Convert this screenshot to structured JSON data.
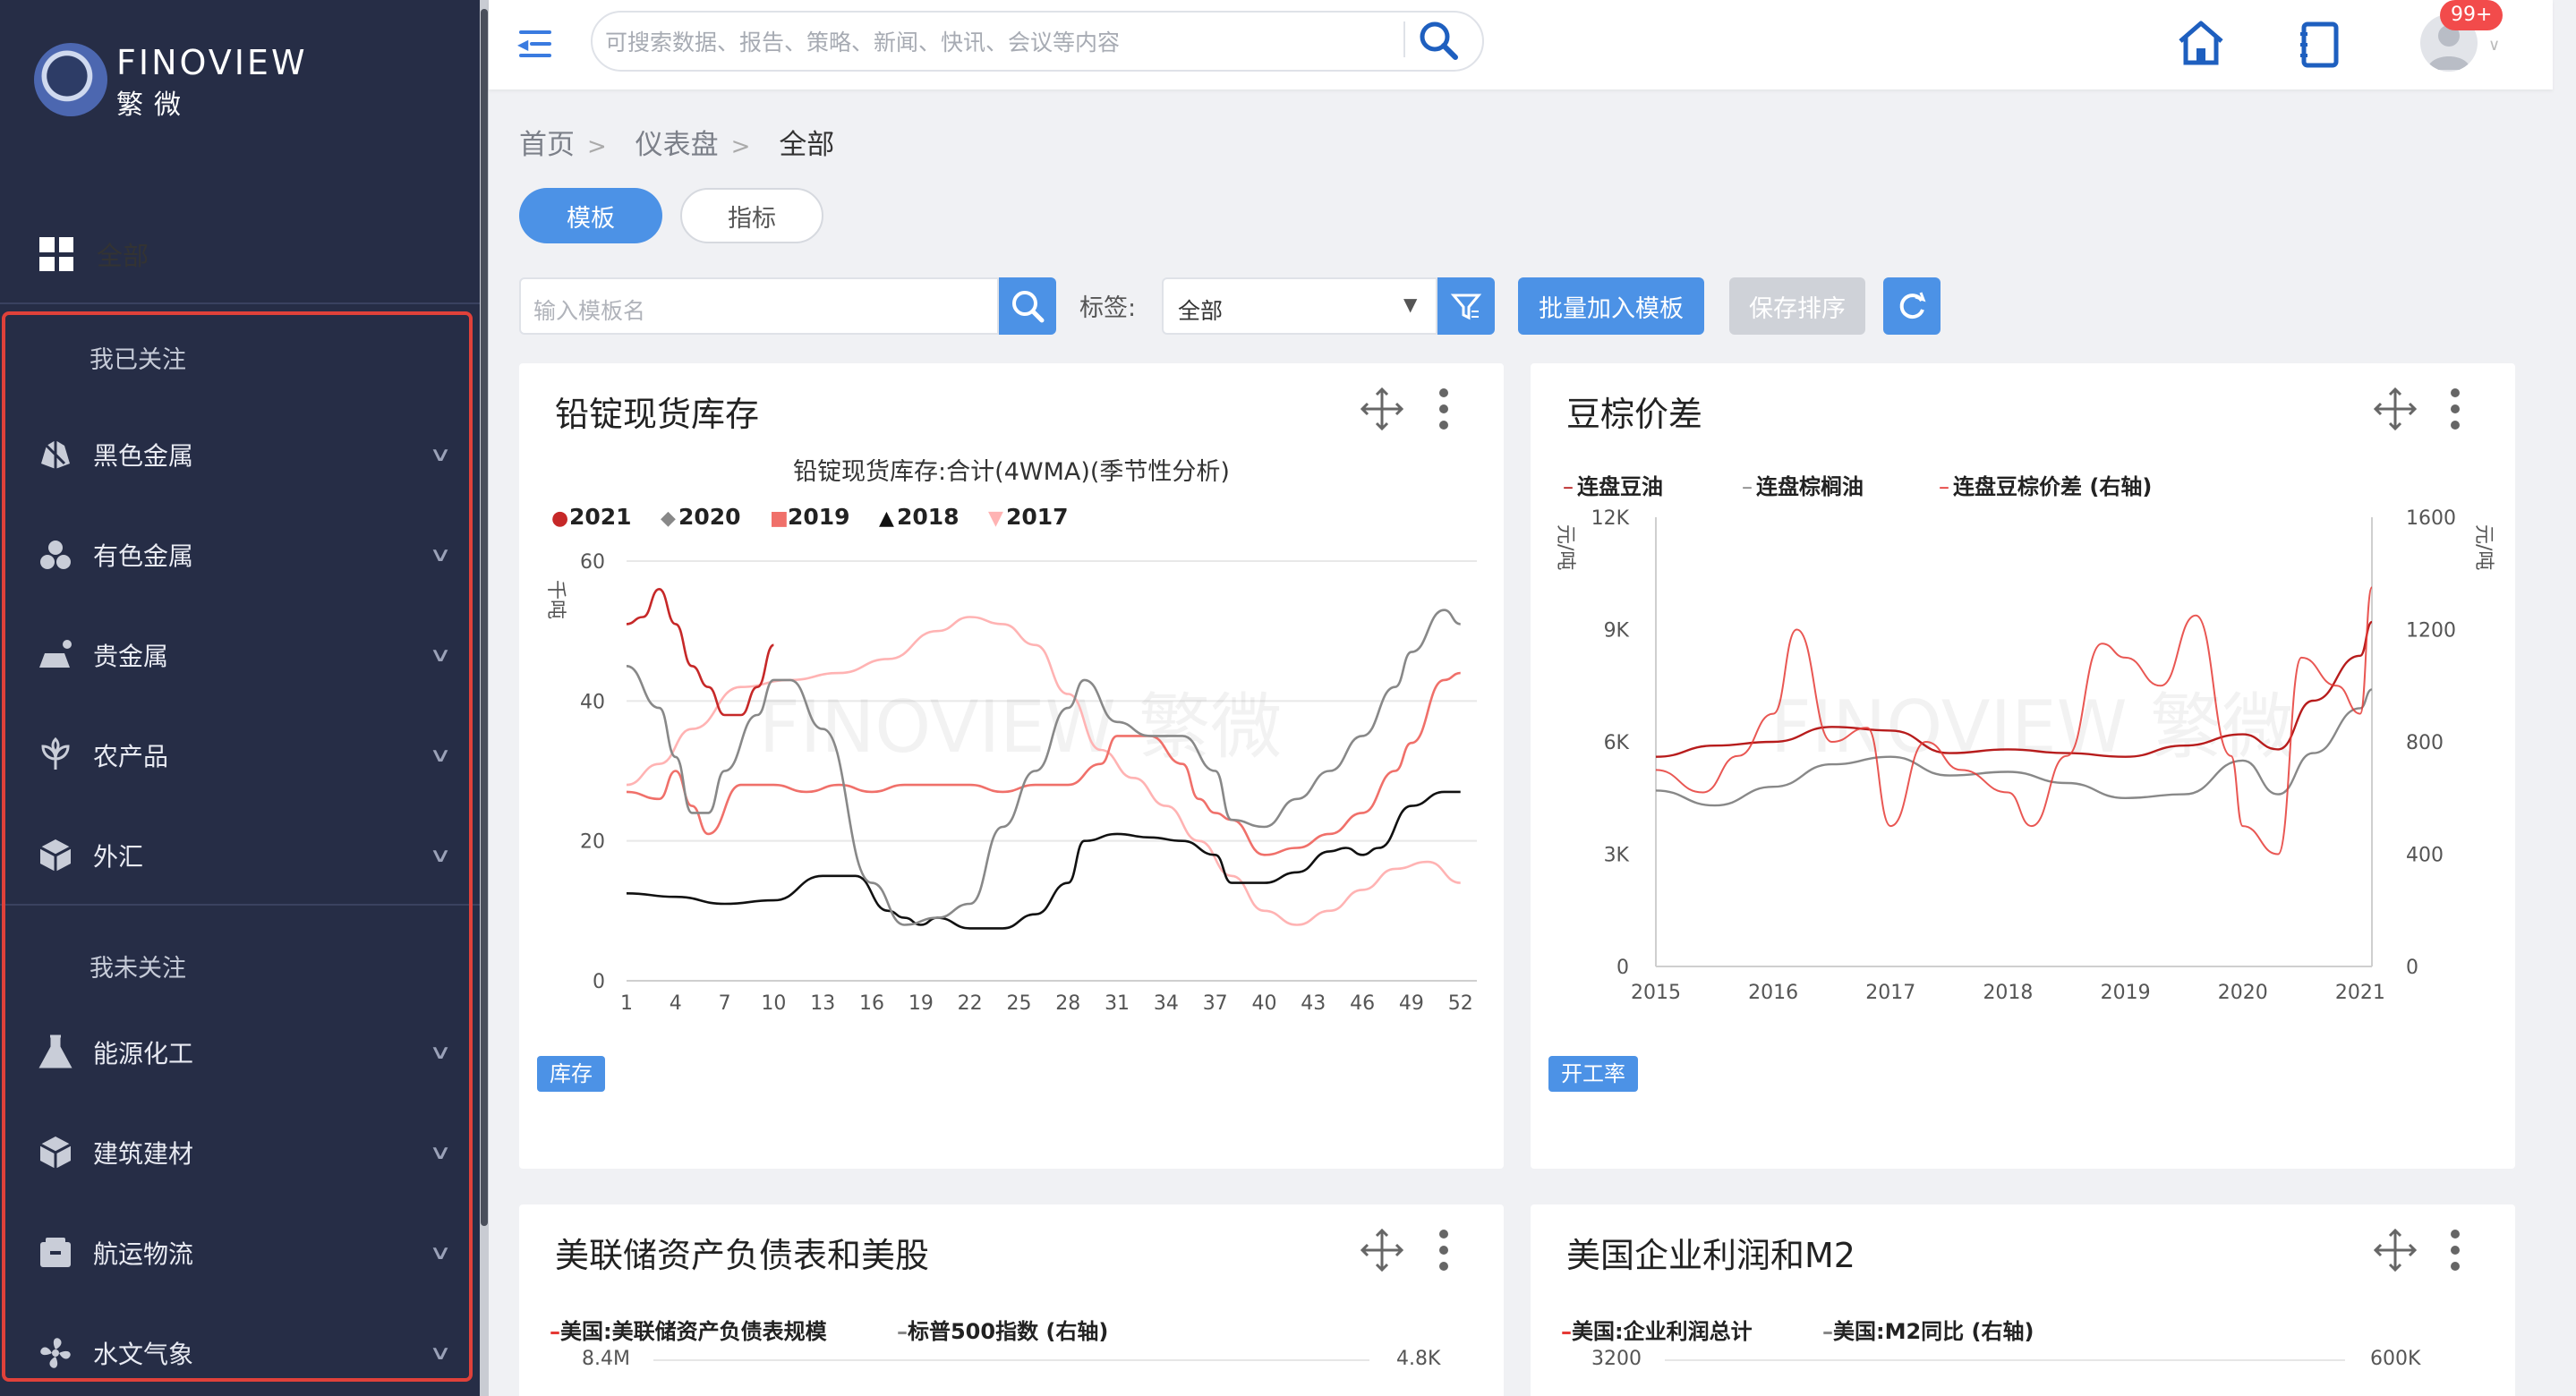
{
  "brand": {
    "name": "FINOVIEW",
    "sub": "繁微"
  },
  "sidebar": {
    "all_label": "全部",
    "followed_header": "我已关注",
    "unfollowed_header": "我未关注",
    "followed": [
      {
        "label": "黑色金属",
        "icon": "ore-icon"
      },
      {
        "label": "有色金属",
        "icon": "metal-balls-icon"
      },
      {
        "label": "贵金属",
        "icon": "gold-bar-icon"
      },
      {
        "label": "农产品",
        "icon": "plant-icon"
      },
      {
        "label": "外汇",
        "icon": "cube-icon"
      }
    ],
    "unfollowed": [
      {
        "label": "能源化工",
        "icon": "flask-icon"
      },
      {
        "label": "建筑建材",
        "icon": "box-icon"
      },
      {
        "label": "航运物流",
        "icon": "container-icon"
      },
      {
        "label": "水文气象",
        "icon": "fan-icon"
      }
    ]
  },
  "header": {
    "search_placeholder": "可搜索数据、报告、策略、新闻、快讯、会议等内容",
    "badge": "99+"
  },
  "breadcrumb": [
    "首页",
    "仪表盘",
    "全部"
  ],
  "tabs": [
    {
      "label": "模板",
      "active": true
    },
    {
      "label": "指标",
      "active": false
    }
  ],
  "toolbar": {
    "template_placeholder": "输入模板名",
    "tag_label": "标签:",
    "tag_value": "全部",
    "batch_add": "批量加入模板",
    "save_order": "保存排序"
  },
  "cards": [
    {
      "title": "铅锭现货库存",
      "tag": "库存"
    },
    {
      "title": "豆棕价差",
      "tag": "开工率"
    },
    {
      "title": "美联储资产负债表和美股"
    },
    {
      "title": "美国企业利润和M2"
    }
  ],
  "chart_data": [
    {
      "type": "line",
      "title": "铅锭现货库存:合计(4WMA)(季节性分析)",
      "ylabel": "千吨",
      "ylim": [
        0,
        60
      ],
      "yticks": [
        0,
        20,
        40,
        60
      ],
      "xticks": [
        1,
        4,
        7,
        10,
        13,
        16,
        19,
        22,
        25,
        28,
        31,
        34,
        37,
        40,
        43,
        46,
        49,
        52
      ],
      "series": [
        {
          "name": "2021",
          "color": "#c62828",
          "marker": "●",
          "x": [
            1,
            2,
            3,
            4,
            5,
            6,
            7,
            8,
            9,
            10
          ],
          "values": [
            51,
            52,
            56,
            51,
            45,
            42,
            38,
            38,
            42,
            48
          ]
        },
        {
          "name": "2020",
          "color": "#888888",
          "marker": "◆",
          "x": [
            1,
            3,
            4,
            5,
            6,
            7,
            9,
            10,
            11,
            13,
            16,
            18,
            20,
            22,
            24,
            26,
            28,
            29,
            31,
            33,
            35,
            37,
            38,
            40,
            42,
            44,
            46,
            48,
            49,
            51,
            52
          ],
          "values": [
            45,
            39,
            32,
            24,
            24,
            30,
            38,
            43,
            43,
            36,
            14,
            8,
            9,
            11,
            22,
            30,
            39,
            43,
            37,
            35,
            35,
            30,
            23,
            22,
            26,
            30,
            35,
            42,
            47,
            53,
            51
          ]
        },
        {
          "name": "2019",
          "color": "#f0706a",
          "marker": "■",
          "x": [
            1,
            3,
            4,
            5,
            6,
            8,
            10,
            12,
            14,
            16,
            18,
            20,
            22,
            24,
            26,
            28,
            30,
            31,
            33,
            35,
            36,
            37,
            38,
            40,
            42,
            44,
            46,
            48,
            49,
            51,
            52
          ],
          "values": [
            27,
            26,
            30,
            25,
            21,
            28,
            28,
            27,
            28,
            27,
            28,
            28,
            28,
            27,
            28,
            28,
            31,
            35,
            35,
            31,
            26,
            24,
            23,
            18,
            19,
            21,
            24,
            30,
            34,
            43,
            44
          ]
        },
        {
          "name": "2018",
          "color": "#111111",
          "marker": "▲",
          "x": [
            1,
            4,
            7,
            10,
            13,
            15,
            17,
            18,
            19,
            20,
            22,
            24,
            26,
            28,
            29,
            31,
            33,
            35,
            37,
            38,
            40,
            42,
            44,
            45,
            46,
            47,
            49,
            51,
            52
          ],
          "values": [
            12.5,
            12,
            11,
            11.5,
            15,
            15,
            10,
            9,
            8,
            9,
            7.5,
            7.5,
            9.5,
            14,
            20,
            21,
            20.5,
            20,
            18,
            14,
            14,
            15.5,
            18.5,
            19,
            18,
            19,
            25,
            27,
            27
          ]
        },
        {
          "name": "2017",
          "color": "#ffb3b3",
          "marker": "▼",
          "x": [
            1,
            3,
            5,
            8,
            11,
            14,
            17,
            20,
            22,
            24,
            26,
            28,
            30,
            32,
            34,
            36,
            38,
            40,
            42,
            44,
            46,
            48,
            50,
            52
          ],
          "values": [
            28,
            31,
            36,
            42,
            43,
            44,
            46,
            50,
            52,
            51,
            48,
            41,
            33,
            29,
            25,
            20,
            15,
            10,
            8,
            10,
            13,
            16,
            17,
            14
          ]
        }
      ]
    },
    {
      "type": "line",
      "ylabel_left": "元/吨",
      "ylabel_right": "元/吨",
      "ylim": [
        0,
        12000
      ],
      "yticks": [
        0,
        3000,
        6000,
        9000,
        12000
      ],
      "ytick_labels": [
        "0",
        "3K",
        "6K",
        "9K",
        "12K"
      ],
      "y2lim": [
        0,
        1600
      ],
      "y2ticks": [
        0,
        400,
        800,
        1200,
        1600
      ],
      "xlim": [
        2015,
        2021.1
      ],
      "xticks": [
        2015,
        2016,
        2017,
        2018,
        2019,
        2020,
        2021
      ],
      "series": [
        {
          "name": "连盘豆油",
          "color": "#b71c1c",
          "axis": "left",
          "x": [
            2015,
            2015.5,
            2016,
            2016.5,
            2017,
            2017.5,
            2018,
            2018.5,
            2019,
            2019.5,
            2020,
            2020.3,
            2020.6,
            2021,
            2021.1
          ],
          "values": [
            5600,
            5900,
            6000,
            6400,
            6300,
            5700,
            5800,
            5700,
            5600,
            5900,
            6200,
            5800,
            7100,
            8300,
            9200
          ]
        },
        {
          "name": "连盘棕榈油",
          "color": "#888888",
          "axis": "left",
          "x": [
            2015,
            2015.5,
            2016,
            2016.5,
            2017,
            2017.5,
            2018,
            2018.5,
            2019,
            2019.5,
            2020,
            2020.3,
            2020.6,
            2021,
            2021.1
          ],
          "values": [
            4700,
            4300,
            4800,
            5400,
            5600,
            5100,
            5200,
            4900,
            4500,
            4600,
            5500,
            4600,
            5700,
            6900,
            7400
          ]
        },
        {
          "name": "连盘豆棕价差 (右轴)",
          "color": "#e53935",
          "axis": "right",
          "x": [
            2015,
            2015.4,
            2015.7,
            2016,
            2016.2,
            2016.5,
            2016.8,
            2017,
            2017.3,
            2017.6,
            2018,
            2018.2,
            2018.5,
            2018.8,
            2019,
            2019.3,
            2019.6,
            2019.9,
            2020,
            2020.3,
            2020.5,
            2020.8,
            2021,
            2021.1
          ],
          "values": [
            700,
            620,
            750,
            900,
            1200,
            800,
            850,
            500,
            800,
            700,
            620,
            500,
            750,
            1150,
            1100,
            1000,
            1250,
            750,
            500,
            400,
            1100,
            1000,
            900,
            1350
          ]
        }
      ]
    },
    {
      "type": "line",
      "series": [
        {
          "name": "美国:美联储资产负债表规模"
        },
        {
          "name": "标普500指数 (右轴)"
        }
      ],
      "ytick_top_left": "8.4M",
      "ytick_top_right": "4.8K"
    },
    {
      "type": "line",
      "series": [
        {
          "name": "美国:企业利润总计"
        },
        {
          "name": "美国:M2同比 (右轴)"
        }
      ],
      "ytick_top_left": "3200",
      "ytick_top_right": "600K"
    }
  ]
}
